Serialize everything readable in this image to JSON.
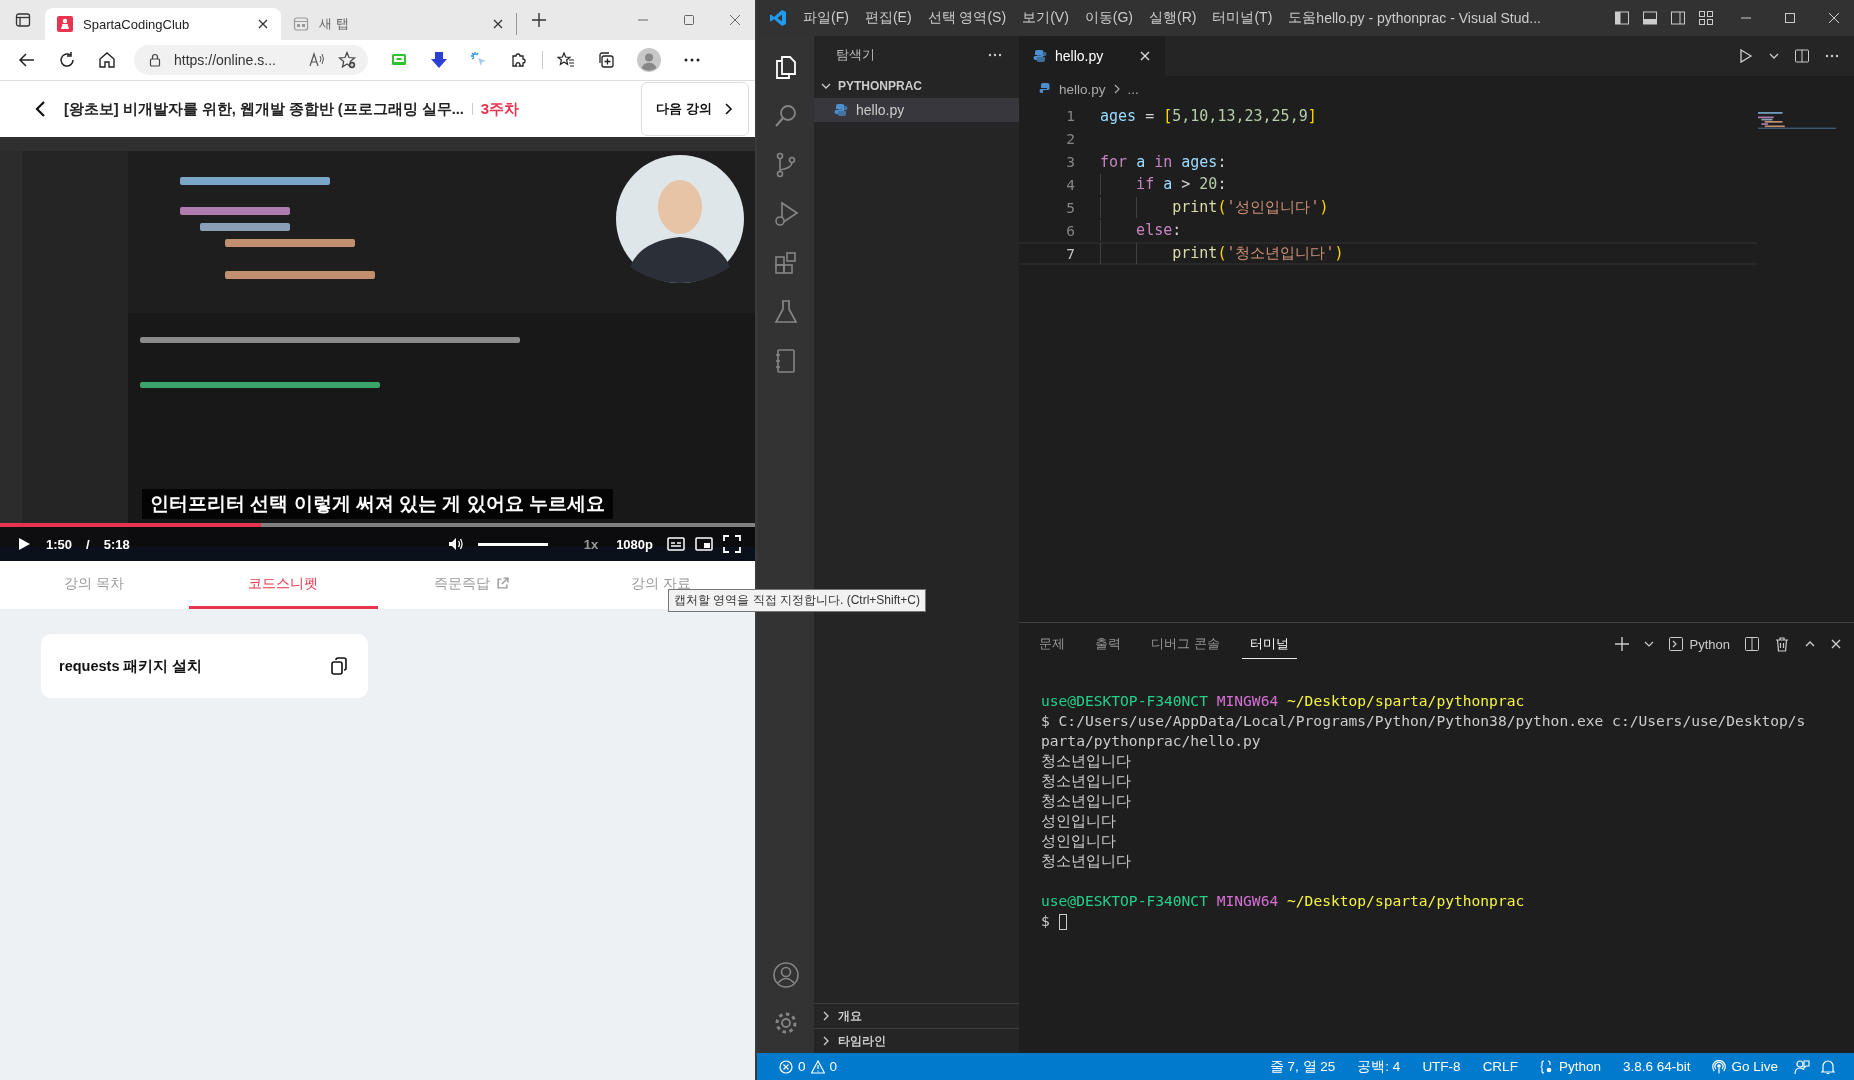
{
  "browser": {
    "tabs": [
      {
        "title": "SpartaCodingClub",
        "selected": true,
        "kind": "site"
      },
      {
        "title": "새 탭",
        "selected": false,
        "kind": "newtab"
      }
    ],
    "address": "https://online.s...",
    "page_header": {
      "title": "[왕초보] 비개발자를 위한, 웹개발 종합반 (프로그래밍 실무...",
      "week": "3주차",
      "next_button": "다음 강의"
    },
    "video": {
      "kind": "picture",
      "subtitle": "인터프리터 선택 이렇게 써져 있는 게 있어요 누르세요",
      "level": 0.346,
      "time_current": "1:50",
      "separator": "/",
      "time_total": "5:18",
      "volume": {
        "level": 1
      },
      "speed": "1x",
      "quality": "1080p"
    },
    "lecture_tabs": [
      {
        "label": "강의 목차",
        "selected": false,
        "external": false
      },
      {
        "label": "코드스니펫",
        "selected": true,
        "external": false
      },
      {
        "label": "즉문즉답",
        "selected": false,
        "external": true
      },
      {
        "label": "강의 자료",
        "selected": false,
        "external": false
      }
    ],
    "snippets": [
      {
        "title": "requests 패키지 설치"
      }
    ],
    "tooltip": "캡처할 영역을 직접 지정합니다. (Ctrl+Shift+C)"
  },
  "vscode": {
    "menu": [
      "파일(F)",
      "편집(E)",
      "선택 영역(S)",
      "보기(V)",
      "이동(G)",
      "실행(R)",
      "터미널(T)",
      "도움"
    ],
    "title": "hello.py - pythonprac - Visual Stud...",
    "activity": [
      {
        "kind": "files",
        "selected": true
      },
      {
        "kind": "search",
        "selected": false
      },
      {
        "kind": "scm",
        "selected": false
      },
      {
        "kind": "debug",
        "selected": false
      },
      {
        "kind": "extensions",
        "selected": false
      },
      {
        "kind": "testing",
        "selected": false
      },
      {
        "kind": "notebook",
        "selected": false
      }
    ],
    "sidebar": {
      "title": "탐색기",
      "folder": "PYTHONPRAC",
      "files": [
        {
          "name": "hello.py",
          "selected": true
        }
      ],
      "sections": [
        "개요",
        "타임라인"
      ]
    },
    "editor_tabs": [
      {
        "name": "hello.py",
        "selected": true
      }
    ],
    "breadcrumb": [
      "hello.py",
      "..."
    ],
    "code": [
      {
        "number": "1",
        "current": false,
        "tokens": [
          {
            "kind": "var",
            "text": "ages"
          },
          {
            "kind": "op",
            "text": " = "
          },
          {
            "kind": "bracket",
            "text": "["
          },
          {
            "kind": "num",
            "text": "5,10,13,23,25,9"
          },
          {
            "kind": "bracket",
            "text": "]"
          }
        ]
      },
      {
        "number": "2",
        "current": false
      },
      {
        "number": "3",
        "current": false,
        "tokens": [
          {
            "kind": "keyword",
            "text": "for "
          },
          {
            "kind": "var",
            "text": "a "
          },
          {
            "kind": "keyword",
            "text": "in "
          },
          {
            "kind": "var",
            "text": "ages"
          },
          {
            "kind": "op",
            "text": ":"
          }
        ],
        "children": [
          {
            "number": "4",
            "current": false,
            "tokens": [
              {
                "kind": "keyword",
                "text": "if "
              },
              {
                "kind": "var",
                "text": "a "
              },
              {
                "kind": "op",
                "text": "> "
              },
              {
                "kind": "num",
                "text": "20"
              },
              {
                "kind": "op",
                "text": ":"
              }
            ],
            "children": [
              {
                "number": "5",
                "current": false,
                "tokens": [
                  {
                    "kind": "func",
                    "text": "print"
                  },
                  {
                    "kind": "bracket",
                    "text": "("
                  },
                  {
                    "kind": "string",
                    "text": "'성인입니다'"
                  },
                  {
                    "kind": "bracket",
                    "text": ")"
                  }
                ]
              }
            ]
          },
          {
            "number": "6",
            "current": false,
            "tokens": [
              {
                "kind": "keyword",
                "text": "else"
              },
              {
                "kind": "op",
                "text": ":"
              }
            ],
            "children": [
              {
                "number": "7",
                "current": true,
                "tokens": [
                  {
                    "kind": "func",
                    "text": "print"
                  },
                  {
                    "kind": "bracket",
                    "text": "("
                  },
                  {
                    "kind": "string",
                    "text": "'청소년입니다'"
                  },
                  {
                    "kind": "bracket",
                    "text": ")"
                  }
                ]
              }
            ]
          }
        ]
      }
    ],
    "panel_tabs": [
      {
        "label": "문제",
        "selected": false
      },
      {
        "label": "출력",
        "selected": false
      },
      {
        "label": "디버그 콘솔",
        "selected": false
      },
      {
        "label": "터미널",
        "selected": true
      }
    ],
    "terminal_name": "Python",
    "terminal": [
      [
        [
          {
            "kind": "user",
            "text": "use@DESKTOP-F340NCT"
          },
          {
            "kind": "shell",
            "text": " MINGW64"
          },
          {
            "kind": "path",
            "text": " ~/Desktop/sparta/pythonprac"
          }
        ],
        [
          {
            "kind": "plain",
            "text": "$ C:/Users/use/AppData/Local/Programs/Python/Python38/python.exe c:/Users/use/Desktop/s"
          }
        ],
        [
          {
            "kind": "plain",
            "text": "parta/pythonprac/hello.py"
          }
        ],
        [
          {
            "kind": "plain",
            "text": "청소년입니다"
          }
        ],
        [
          {
            "kind": "plain",
            "text": "청소년입니다"
          }
        ],
        [
          {
            "kind": "plain",
            "text": "청소년입니다"
          }
        ],
        [
          {
            "kind": "plain",
            "text": "성인입니다"
          }
        ],
        [
          {
            "kind": "plain",
            "text": "성인입니다"
          }
        ],
        [
          {
            "kind": "plain",
            "text": "청소년입니다"
          }
        ]
      ],
      [
        [
          {
            "kind": "user",
            "text": "use@DESKTOP-F340NCT"
          },
          {
            "kind": "shell",
            "text": " MINGW64"
          },
          {
            "kind": "path",
            "text": " ~/Desktop/sparta/pythonprac"
          }
        ],
        [
          {
            "kind": "plain",
            "text": "$ "
          },
          {
            "kind": "cursor"
          }
        ]
      ]
    ],
    "status": {
      "errors": "0",
      "warnings": "0",
      "items": [
        {
          "kind": "text",
          "text": "줄 7, 열 25"
        },
        {
          "kind": "text",
          "text": "공백: 4"
        },
        {
          "kind": "text",
          "text": "UTF-8"
        },
        {
          "kind": "text",
          "text": "CRLF"
        },
        {
          "kind": "language",
          "text": "Python"
        },
        {
          "kind": "text",
          "text": "3.8.6 64-bit"
        },
        {
          "kind": "live",
          "text": "Go Live"
        }
      ]
    }
  }
}
